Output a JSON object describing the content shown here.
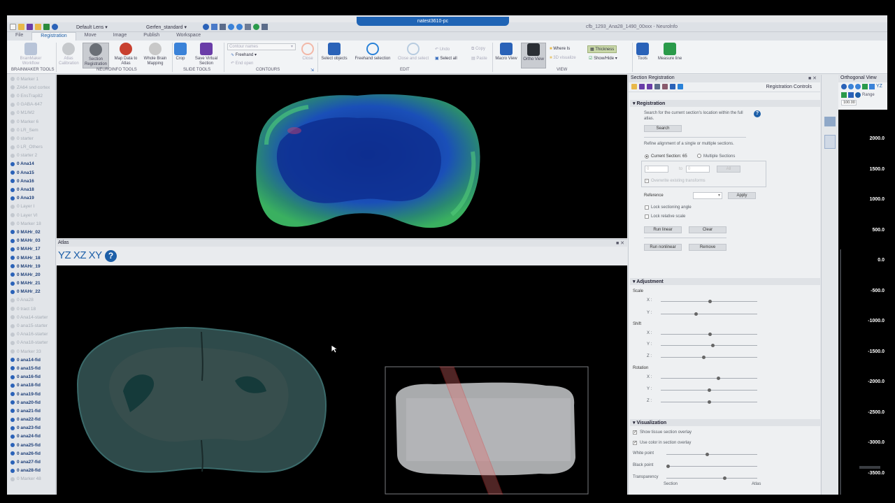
{
  "window": {
    "lens": "Default Lens",
    "profile": "Gerfen_standard",
    "remote_host": "natest3610-pc",
    "title": "cfb_1293_Ana28_1490_00xxx - Neurolnfo"
  },
  "ribbon": {
    "tabs": [
      "File",
      "Registration",
      "Move",
      "Image",
      "Publish",
      "Workspace"
    ],
    "active_tab": "Registration",
    "buttons": {
      "brainmaker_workflow": "BrainMaker Workflow",
      "atlas_calibration": "Atlas Calibration",
      "section_registration": "Section Registration",
      "map_data_to_atlas": "Map Data to Atlas",
      "whole_brain_mapping": "Whole Brain Mapping",
      "crop": "Crop",
      "save_virtual_section": "Save Virtual Section",
      "contour_names": "Contour names",
      "freehand": "Freehand",
      "end_open": "End open",
      "close": "Close",
      "select_objects": "Select objects",
      "freehand_selection": "Freehand selection",
      "close_and_select": "Close and select",
      "undo": "Undo",
      "select_all": "Select all",
      "copy": "Copy",
      "paste": "Paste",
      "macro_view": "Macro View",
      "ortho_view": "Ortho View",
      "where_is": "Where Is",
      "3d_visualize": "3D visualize",
      "thickness": "Thickness",
      "show_hide": "Show/Hide",
      "tools": "Tools",
      "measure_line": "Measure line"
    },
    "groups": {
      "brainmaker_tools": "BRAINMAKER TOOLS",
      "neuroinfo_tools": "NEUROINFO TOOLS",
      "slide_tools": "SLIDE TOOLS",
      "contours": "CONTOURS",
      "edit": "EDIT",
      "view": "VIEW"
    }
  },
  "markers": [
    {
      "label": "0 Marker 1",
      "on": false
    },
    {
      "label": "ZA64 snd cortex",
      "on": false
    },
    {
      "label": "0 EnsTrap82",
      "on": false
    },
    {
      "label": "0 GABA-647",
      "on": false
    },
    {
      "label": "0 M1/M2",
      "on": false
    },
    {
      "label": "0 Marker 6",
      "on": false
    },
    {
      "label": "0 LR_Sem",
      "on": false
    },
    {
      "label": "0 starter",
      "on": false
    },
    {
      "label": "0 LR_Others",
      "on": false
    },
    {
      "label": "0 starter 2",
      "on": false
    },
    {
      "label": "0 Ana14",
      "on": true
    },
    {
      "label": "0 Ana15",
      "on": true
    },
    {
      "label": "0 Ana16",
      "on": true
    },
    {
      "label": "0 Ana18",
      "on": true
    },
    {
      "label": "0 Ana19",
      "on": true
    },
    {
      "label": "0 Layer I",
      "on": false
    },
    {
      "label": "0 Layer VI",
      "on": false
    },
    {
      "label": "0 Marker 18",
      "on": false
    },
    {
      "label": "0 MAHr_02",
      "on": true
    },
    {
      "label": "0 MAHr_03",
      "on": true
    },
    {
      "label": "0 MAHr_17",
      "on": true
    },
    {
      "label": "0 MAHr_18",
      "on": true
    },
    {
      "label": "0 MAHr_19",
      "on": true
    },
    {
      "label": "0 MAHr_20",
      "on": true
    },
    {
      "label": "0 MAHr_21",
      "on": true
    },
    {
      "label": "0 MAHr_22",
      "on": true
    },
    {
      "label": "0 Ana28",
      "on": false
    },
    {
      "label": "0 tract 18",
      "on": false
    },
    {
      "label": "0 Ana14-starter",
      "on": false
    },
    {
      "label": "0 ana15-starter",
      "on": false
    },
    {
      "label": "0 Ana16-starter",
      "on": false
    },
    {
      "label": "0 Ana18-starter",
      "on": false
    },
    {
      "label": "0 Marker 33",
      "on": false
    },
    {
      "label": "0 ana14-fid",
      "on": true
    },
    {
      "label": "0 ana15-fid",
      "on": true
    },
    {
      "label": "0 ana16-fid",
      "on": true
    },
    {
      "label": "0 ana18-fid",
      "on": true
    },
    {
      "label": "0 ana19-fid",
      "on": true
    },
    {
      "label": "0 ana20-fid",
      "on": true
    },
    {
      "label": "0 ana21-fid",
      "on": true
    },
    {
      "label": "0 ana22-fid",
      "on": true
    },
    {
      "label": "0 ana23-fid",
      "on": true
    },
    {
      "label": "0 ana24-fid",
      "on": true
    },
    {
      "label": "0 ana25-fid",
      "on": true
    },
    {
      "label": "0 ana26-fid",
      "on": true
    },
    {
      "label": "0 ana27-fid",
      "on": true
    },
    {
      "label": "0 ana28-fid",
      "on": true
    },
    {
      "label": "0 Marker 48",
      "on": false
    }
  ],
  "atlas": {
    "title": "Atlas",
    "planes": "YZ XZ XY",
    "help_icon": "?"
  },
  "registration_panel": {
    "title": "Section Registration",
    "controls_label": "Registration Controls",
    "registration": {
      "header": "Registration",
      "search_hint": "Search for the current section's location within the full atlas.",
      "search_button": "Search",
      "refine_hint": "Refine alignment of a single or multiple sections.",
      "current_section": "Current Section: 65",
      "multiple_sections": "Multiple Sections",
      "from_value": "0",
      "to_label": "to",
      "to_value": "0",
      "all_button": "All",
      "overwrite": "Overwrite existing transforms",
      "reference_label": "Reference",
      "apply_button": "Apply",
      "lock_angle": "Lock sectioning angle",
      "lock_scale": "Lock relative scale",
      "run_linear": "Run linear",
      "clear": "Clear",
      "run_nonlinear": "Run nonlinear",
      "remove": "Remove"
    },
    "adjustment": {
      "header": "Adjustment",
      "scale": "Scale",
      "shift": "Shift",
      "rotation": "Rotation",
      "x": "X :",
      "y": "Y :",
      "z": "Z :",
      "scale_x": 0.51,
      "scale_y": 0.36,
      "shift_x": 0.51,
      "shift_y": 0.54,
      "shift_z": 0.44,
      "rot_x": 0.6,
      "rot_y": 0.5,
      "rot_z": 0.5
    },
    "visualization": {
      "header": "Visualization",
      "show_overlay": "Show tissue section overlay",
      "use_color": "Use color in section overlay",
      "white_point": "White point",
      "black_point": "Black point",
      "transparency": "Transparency",
      "section": "Section",
      "atlas": "Atlas",
      "white_value": 0.45,
      "black_value": 0.0,
      "transparency_value": 0.65
    }
  },
  "ortho": {
    "title": "Orthogonal View",
    "range_label": "Range",
    "range_value": "100.00",
    "plane_active": "YZ",
    "ticks": [
      "2000.0",
      "1500.0",
      "1000.0",
      "500.0",
      "0.0",
      "-500.0",
      "-1000.0",
      "-1500.0",
      "-2000.0",
      "-2500.0",
      "-3000.0",
      "-3500.0"
    ]
  }
}
